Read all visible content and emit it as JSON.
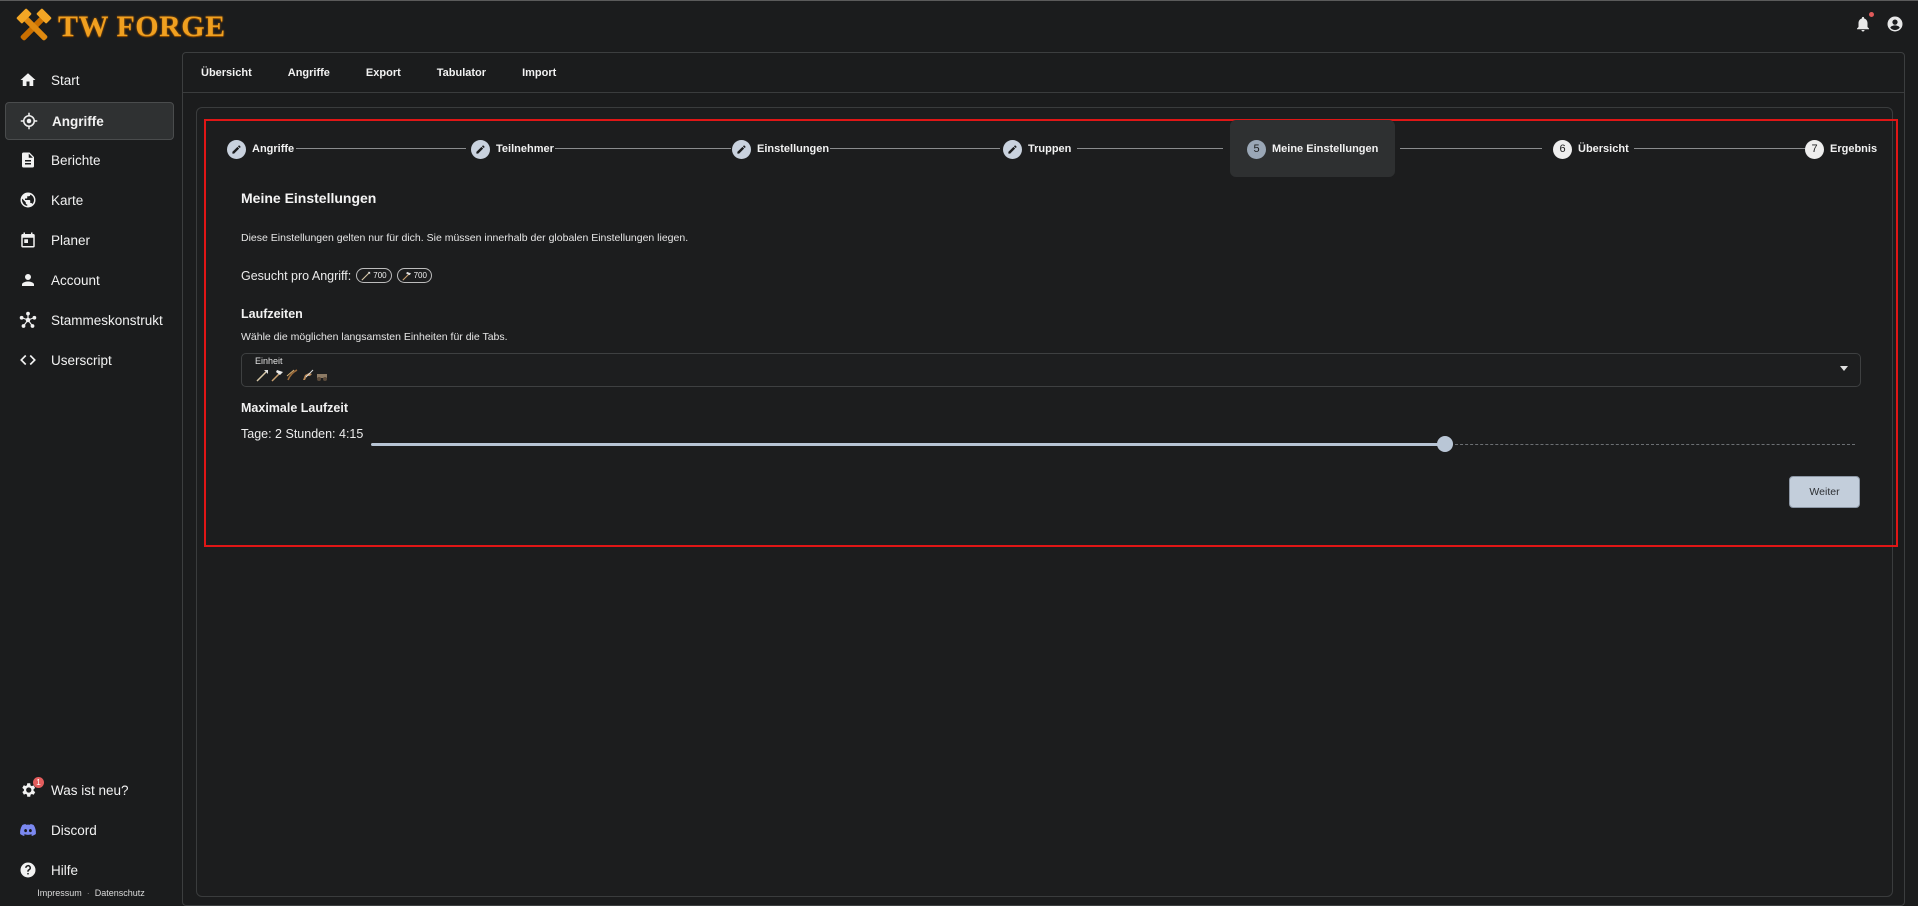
{
  "app": {
    "title": "TW FORGE",
    "logo_icon": "crossed-hammers-icon",
    "accent_color": "#f0a020"
  },
  "header": {
    "icons": [
      "bell-icon",
      "account-circle-icon"
    ]
  },
  "sidebar": {
    "items": [
      {
        "label": "Start",
        "icon": "home-icon"
      },
      {
        "label": "Angriffe",
        "icon": "target-icon",
        "active": true
      },
      {
        "label": "Berichte",
        "icon": "document-icon"
      },
      {
        "label": "Karte",
        "icon": "globe-icon"
      },
      {
        "label": "Planer",
        "icon": "calendar-icon"
      },
      {
        "label": "Account",
        "icon": "person-icon"
      },
      {
        "label": "Stammeskonstrukt",
        "icon": "network-icon"
      },
      {
        "label": "Userscript",
        "icon": "code-icon"
      }
    ],
    "bottom_items": [
      {
        "label": "Was ist neu?",
        "icon": "gear-sparkle-icon",
        "badge": "1"
      },
      {
        "label": "Discord",
        "icon": "discord-icon"
      },
      {
        "label": "Hilfe",
        "icon": "help-icon"
      }
    ],
    "footer": {
      "impressum": "Impressum",
      "separator": "·",
      "datenschutz": "Datenschutz"
    }
  },
  "tabs": [
    "Übersicht",
    "Angriffe",
    "Export",
    "Tabulator",
    "Import"
  ],
  "stepper": {
    "steps": [
      {
        "label": "Angriffe",
        "state": "done"
      },
      {
        "label": "Teilnehmer",
        "state": "done"
      },
      {
        "label": "Einstellungen",
        "state": "done"
      },
      {
        "label": "Truppen",
        "state": "done"
      },
      {
        "label": "Meine Einstellungen",
        "number": "5",
        "state": "active"
      },
      {
        "label": "Übersicht",
        "number": "6",
        "state": "todo"
      },
      {
        "label": "Ergebnis",
        "number": "7",
        "state": "todo"
      }
    ]
  },
  "content": {
    "title": "Meine Einstellungen",
    "description": "Diese Einstellungen gelten nur für dich. Sie müssen innerhalb der globalen Einstellungen liegen.",
    "gesucht_label": "Gesucht pro Angriff:",
    "gesucht_chips": [
      {
        "icon": "spear-icon",
        "value": "700"
      },
      {
        "icon": "axe-icon",
        "value": "700"
      }
    ],
    "laufzeiten_title": "Laufzeiten",
    "laufzeiten_desc": "Wähle die möglichen langsamsten Einheiten für die Tabs.",
    "select": {
      "label": "Einheit",
      "unit_icons": [
        "spear-icon",
        "axe-icon",
        "archer-icon",
        "light-cavalry-icon",
        "ram-icon"
      ]
    },
    "max_title": "Maximale Laufzeit",
    "max_value_text": "Tage: 2 Stunden: 4:15",
    "slider_fraction": 0.724,
    "weiter_label": "Weiter"
  }
}
